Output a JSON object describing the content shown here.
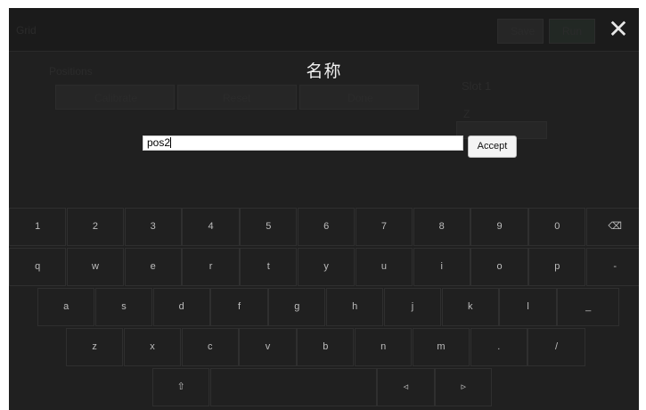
{
  "background_ui": {
    "topbar_left": "Grid",
    "topbar_right_a": "Save",
    "topbar_right_b": "Run",
    "left_label": "Positions",
    "buttons": [
      "Calibrate",
      "Reset",
      "Done"
    ],
    "right_label_1": "Slot 1",
    "right_label_2": "Z"
  },
  "dialog": {
    "title": "名称",
    "input_value": "pos2",
    "accept_label": "Accept",
    "close_glyph": "✕"
  },
  "keyboard": {
    "row1": [
      "1",
      "2",
      "3",
      "4",
      "5",
      "6",
      "7",
      "8",
      "9",
      "0",
      "⌫"
    ],
    "row2": [
      "q",
      "w",
      "e",
      "r",
      "t",
      "y",
      "u",
      "i",
      "o",
      "p",
      "-"
    ],
    "row3": [
      "a",
      "s",
      "d",
      "f",
      "g",
      "h",
      "j",
      "k",
      "l",
      "_"
    ],
    "row4": [
      "z",
      "x",
      "c",
      "v",
      "b",
      "n",
      "m",
      ".",
      "/"
    ],
    "row5": [
      "⇧",
      "",
      "◃",
      "▹"
    ]
  }
}
